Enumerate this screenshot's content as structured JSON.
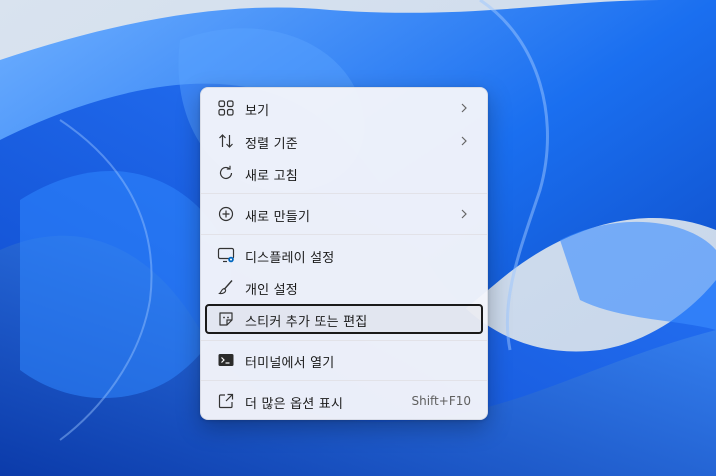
{
  "context_menu": {
    "items": [
      {
        "label": "보기",
        "icon": "view-grid-icon",
        "submenu": true
      },
      {
        "label": "정렬 기준",
        "icon": "sort-arrows-icon",
        "submenu": true
      },
      {
        "label": "새로 고침",
        "icon": "refresh-icon",
        "submenu": false
      },
      {
        "label": "새로 만들기",
        "icon": "new-plus-icon",
        "submenu": true
      },
      {
        "label": "디스플레이 설정",
        "icon": "display-settings-icon",
        "submenu": false
      },
      {
        "label": "개인 설정",
        "icon": "personalize-brush-icon",
        "submenu": false
      },
      {
        "label": "스티커 추가 또는 편집",
        "icon": "sticker-icon",
        "submenu": false,
        "focused": true
      },
      {
        "label": "터미널에서 열기",
        "icon": "terminal-icon",
        "submenu": false
      },
      {
        "label": "더 많은 옵션 표시",
        "icon": "more-options-icon",
        "submenu": false,
        "shortcut": "Shift+F10"
      }
    ]
  },
  "colors": {
    "wallpaper_blue": "#1466e8",
    "wallpaper_bg": "#cfdcec",
    "menu_bg": "#f4f5fa",
    "focus_border": "#1a1a1a",
    "accent": "#0067c0"
  }
}
